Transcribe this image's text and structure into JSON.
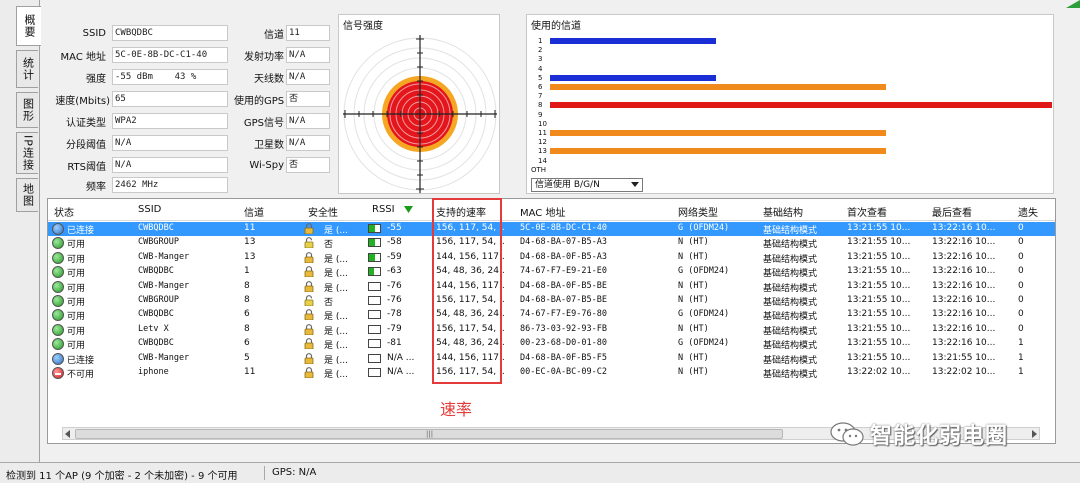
{
  "tabs": [
    "概要",
    "统计",
    "图形",
    "IP连接",
    "地图"
  ],
  "info": {
    "ssid_label": "SSID",
    "ssid": "CWBQDBC",
    "mac_label": "MAC 地址",
    "mac": "5C-0E-8B-DC-C1-40",
    "strength_label": "强度",
    "strength": "-55 dBm    43 %",
    "speed_label": "速度(Mbits)",
    "speed": "65",
    "auth_label": "认证类型",
    "auth": "WPA2",
    "frag_label": "分段阈值",
    "frag": "N/A",
    "rts_label": "RTS阈值",
    "rts": "N/A",
    "freq_label": "频率",
    "freq": "2462 MHz",
    "channel_label": "信道",
    "channel": "11",
    "txpower_label": "发射功率",
    "txpower": "N/A",
    "antenna_label": "天线数",
    "antenna": "N/A",
    "gps_used_label": "使用的GPS",
    "gps_used": "否",
    "gps_signal_label": "GPS信号",
    "gps_signal": "N/A",
    "satellites_label": "卫星数",
    "satellites": "N/A",
    "wispy_label": "Wi-Spy",
    "wispy": "否"
  },
  "signal_panel": {
    "title": "信号强度"
  },
  "channel_panel": {
    "title": "使用的信道",
    "labels": [
      "1",
      "2",
      "3",
      "4",
      "5",
      "6",
      "7",
      "8",
      "9",
      "10",
      "11",
      "12",
      "13",
      "14",
      "OTH"
    ],
    "bars": [
      {
        "channel": 1,
        "fraction": 0.33,
        "color": "#1a2ed6"
      },
      {
        "channel": 5,
        "fraction": 0.33,
        "color": "#1a2ed6"
      },
      {
        "channel": 6,
        "fraction": 0.67,
        "color": "#f08a1c"
      },
      {
        "channel": 8,
        "fraction": 1.0,
        "color": "#e01818"
      },
      {
        "channel": 11,
        "fraction": 0.67,
        "color": "#f08a1c"
      },
      {
        "channel": 13,
        "fraction": 0.67,
        "color": "#f08a1c"
      }
    ],
    "select_value": "信道使用 B/G/N"
  },
  "table": {
    "headers": [
      "状态",
      "SSID",
      "信道",
      "安全性",
      "RSSI",
      "支持的速率",
      "MAC 地址",
      "网络类型",
      "基础结构",
      "首次查看",
      "最后查看",
      "遗失"
    ],
    "rows": [
      {
        "status": "已连接",
        "dot": "blue",
        "ssid": "CWBQDBC",
        "channel": "11",
        "security": "是 (...",
        "rssi": "-55",
        "rssi_fill": 0.55,
        "rates": "156, 117, 54, ...",
        "mac": "5C-0E-8B-DC-C1-40",
        "nettype": "G (OFDM24)",
        "infra": "基础结构模式",
        "first": "13:21:55 10...",
        "last": "13:22:16 10...",
        "lost": "0",
        "selected": true
      },
      {
        "status": "可用",
        "dot": "green",
        "ssid": "CWBGROUP",
        "channel": "13",
        "security": "否",
        "rssi": "-58",
        "rssi_fill": 0.55,
        "rates": "156, 117, 54, ...",
        "mac": "D4-68-BA-07-B5-A3",
        "nettype": "N (HT)",
        "infra": "基础结构模式",
        "first": "13:21:55 10...",
        "last": "13:22:16 10...",
        "lost": "0"
      },
      {
        "status": "可用",
        "dot": "green",
        "ssid": "CWB-Manger",
        "channel": "13",
        "security": "是 (...",
        "rssi": "-59",
        "rssi_fill": 0.55,
        "rates": "144, 156, 117...",
        "mac": "D4-68-BA-0F-B5-A3",
        "nettype": "N (HT)",
        "infra": "基础结构模式",
        "first": "13:21:55 10...",
        "last": "13:22:16 10...",
        "lost": "0"
      },
      {
        "status": "可用",
        "dot": "green",
        "ssid": "CWBQDBC",
        "channel": "1",
        "security": "是 (...",
        "rssi": "-63",
        "rssi_fill": 0.45,
        "rates": "54, 48, 36, 24...",
        "mac": "74-67-F7-E9-21-E0",
        "nettype": "G (OFDM24)",
        "infra": "基础结构模式",
        "first": "13:21:55 10...",
        "last": "13:22:16 10...",
        "lost": "0"
      },
      {
        "status": "可用",
        "dot": "green",
        "ssid": "CWB-Manger",
        "channel": "8",
        "security": "是 (...",
        "rssi": "-76",
        "rssi_fill": 0.0,
        "rates": "144, 156, 117...",
        "mac": "D4-68-BA-0F-B5-BE",
        "nettype": "N (HT)",
        "infra": "基础结构模式",
        "first": "13:21:55 10...",
        "last": "13:22:16 10...",
        "lost": "0"
      },
      {
        "status": "可用",
        "dot": "green",
        "ssid": "CWBGROUP",
        "channel": "8",
        "security": "否",
        "rssi": "-76",
        "rssi_fill": 0.0,
        "rates": "156, 117, 54, ...",
        "mac": "D4-68-BA-07-B5-BE",
        "nettype": "N (HT)",
        "infra": "基础结构模式",
        "first": "13:21:55 10...",
        "last": "13:22:16 10...",
        "lost": "0"
      },
      {
        "status": "可用",
        "dot": "green",
        "ssid": "CWBQDBC",
        "channel": "6",
        "security": "是 (...",
        "rssi": "-78",
        "rssi_fill": 0.0,
        "rates": "54, 48, 36, 24...",
        "mac": "74-67-F7-E9-76-80",
        "nettype": "G (OFDM24)",
        "infra": "基础结构模式",
        "first": "13:21:55 10...",
        "last": "13:22:16 10...",
        "lost": "0"
      },
      {
        "status": "可用",
        "dot": "green",
        "ssid": "Letv X",
        "channel": "8",
        "security": "是 (...",
        "rssi": "-79",
        "rssi_fill": 0.0,
        "rates": "156, 117, 54, ...",
        "mac": "86-73-03-92-93-FB",
        "nettype": "N (HT)",
        "infra": "基础结构模式",
        "first": "13:21:55 10...",
        "last": "13:22:16 10...",
        "lost": "0"
      },
      {
        "status": "可用",
        "dot": "green",
        "ssid": "CWBQDBC",
        "channel": "6",
        "security": "是 (...",
        "rssi": "-81",
        "rssi_fill": 0.0,
        "rates": "54, 48, 36, 24...",
        "mac": "00-23-68-D0-01-80",
        "nettype": "G (OFDM24)",
        "infra": "基础结构模式",
        "first": "13:21:55 10...",
        "last": "13:22:16 10...",
        "lost": "1"
      },
      {
        "status": "已连接",
        "dot": "blue",
        "ssid": "CWB-Manger",
        "channel": "5",
        "security": "是 (...",
        "rssi": "N/A ...",
        "rssi_fill": 0.0,
        "rates": "144, 156, 117...",
        "mac": "D4-68-BA-0F-B5-F5",
        "nettype": "N (HT)",
        "infra": "基础结构模式",
        "first": "13:21:55 10...",
        "last": "13:21:55 10...",
        "lost": "1"
      },
      {
        "status": "不可用",
        "dot": "red",
        "ssid": "iphone",
        "channel": "11",
        "security": "是 (...",
        "rssi": "N/A ...",
        "rssi_fill": 0.0,
        "rates": "156, 117, 54, ...",
        "mac": "00-EC-0A-BC-09-C2",
        "nettype": "N (HT)",
        "infra": "基础结构模式",
        "first": "13:22:02 10...",
        "last": "13:22:02 10...",
        "lost": "1"
      }
    ]
  },
  "annotation": "速率",
  "status_bar": {
    "left": "检测到 11 个AP (9 个加密 - 2 个未加密) - 9 个可用",
    "right": "GPS: N/A"
  },
  "watermark": "智能化弱电圈",
  "colors": {
    "selected_row": "#3399ff",
    "highlight": "#e53a3a"
  }
}
